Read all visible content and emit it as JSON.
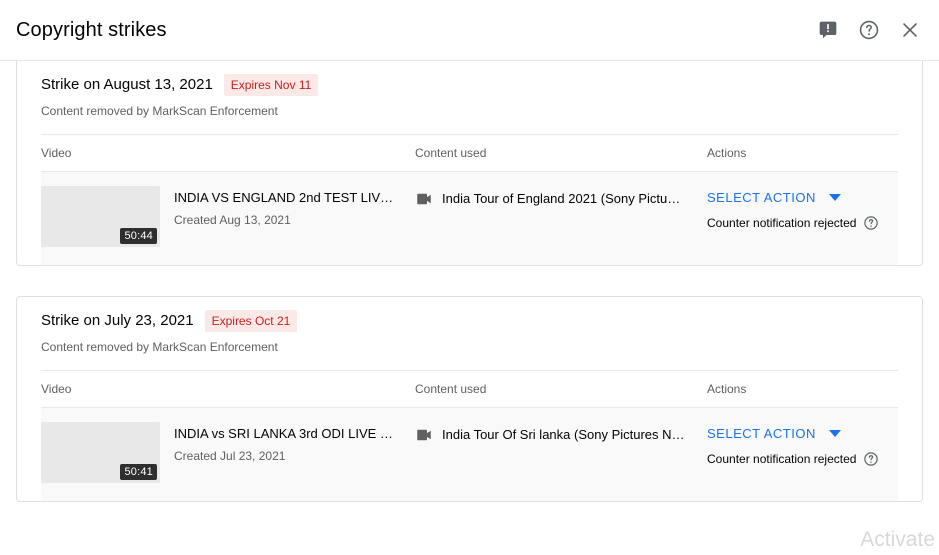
{
  "header": {
    "title": "Copyright strikes",
    "icons": [
      {
        "name": "feedback-icon",
        "label": "Send feedback"
      },
      {
        "name": "help-icon",
        "label": "Help"
      },
      {
        "name": "close-icon",
        "label": "Close"
      }
    ]
  },
  "table_columns": {
    "video": "Video",
    "content_used": "Content used",
    "actions": "Actions"
  },
  "strikes": [
    {
      "title": "Strike on August 13, 2021",
      "expires": "Expires Nov 11",
      "subtitle": "Content removed by MarkScan Enforcement",
      "rows": [
        {
          "video_title": "INDIA VS ENGLAND 2nd TEST LIV…",
          "video_created": "Created Aug 13, 2021",
          "duration": "50:44",
          "content_used": "India Tour of England 2021 (Sony Pictu…",
          "action_label": "SELECT ACTION",
          "status": "Counter notification rejected"
        }
      ]
    },
    {
      "title": "Strike on July 23, 2021",
      "expires": "Expires Oct 21",
      "subtitle": "Content removed by MarkScan Enforcement",
      "rows": [
        {
          "video_title": "INDIA vs SRI LANKA 3rd ODI LIVE …",
          "video_created": "Created Jul 23, 2021",
          "duration": "50:41",
          "content_used": "India Tour Of Sri lanka (Sony Pictures N…",
          "action_label": "SELECT ACTION",
          "status": "Counter notification rejected"
        }
      ]
    }
  ],
  "watermark": "Activate",
  "colors": {
    "link": "#1a73e8",
    "expires_text": "#c5221f",
    "expires_bg": "#fbe9e7",
    "title": "#030303",
    "muted": "#606060",
    "row_bg": "#f9f9f9",
    "thumb_bg": "#e8e8e8"
  }
}
